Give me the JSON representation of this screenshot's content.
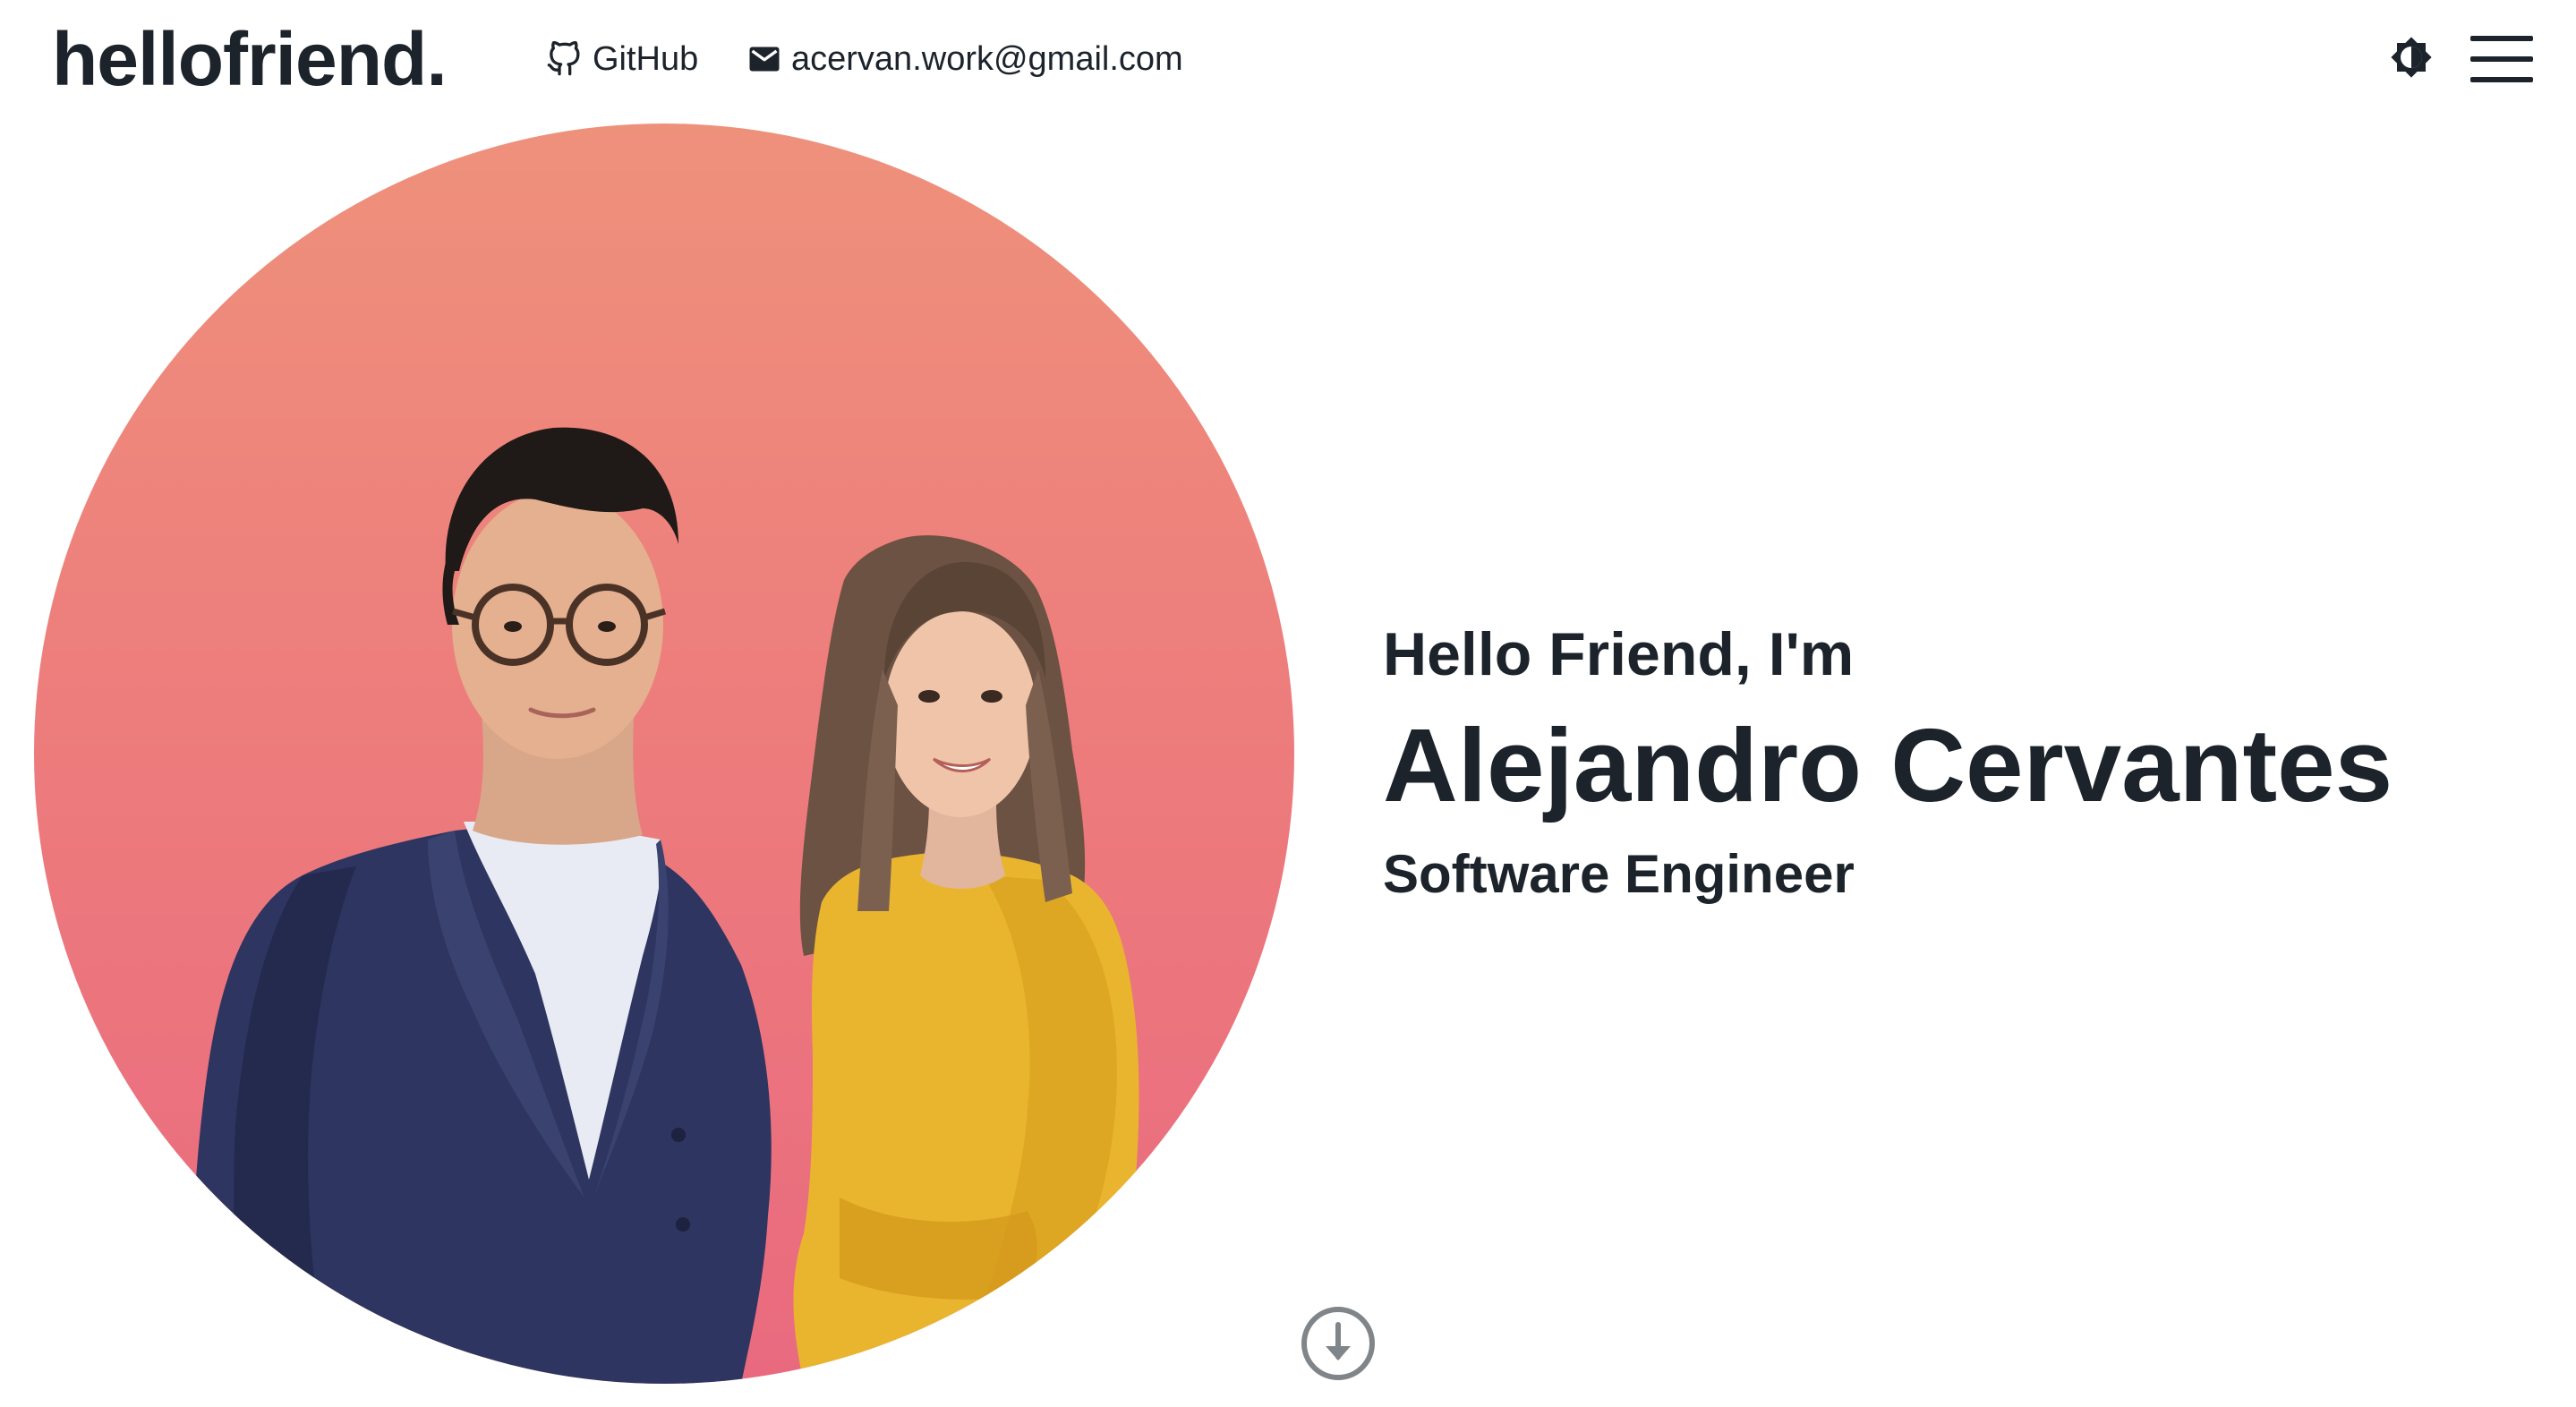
{
  "header": {
    "logo": "hellofriend.",
    "nav": [
      {
        "label": "GitHub",
        "icon": "github-icon"
      },
      {
        "label": "acervan.work@gmail.com",
        "icon": "mail-icon"
      }
    ],
    "theme_toggle_icon": "brightness-icon",
    "menu_icon": "hamburger-icon"
  },
  "hero": {
    "greeting": "Hello Friend, I'm",
    "name": "Alejandro Cervantes",
    "role": "Software Engineer",
    "photo_alt": "portrait-photo",
    "scroll_icon": "arrow-down-circle-icon"
  },
  "colors": {
    "text": "#1c232b",
    "gradient_top": "#ee917b",
    "gradient_bottom": "#e96a7f",
    "scroll_icon": "#808589"
  }
}
